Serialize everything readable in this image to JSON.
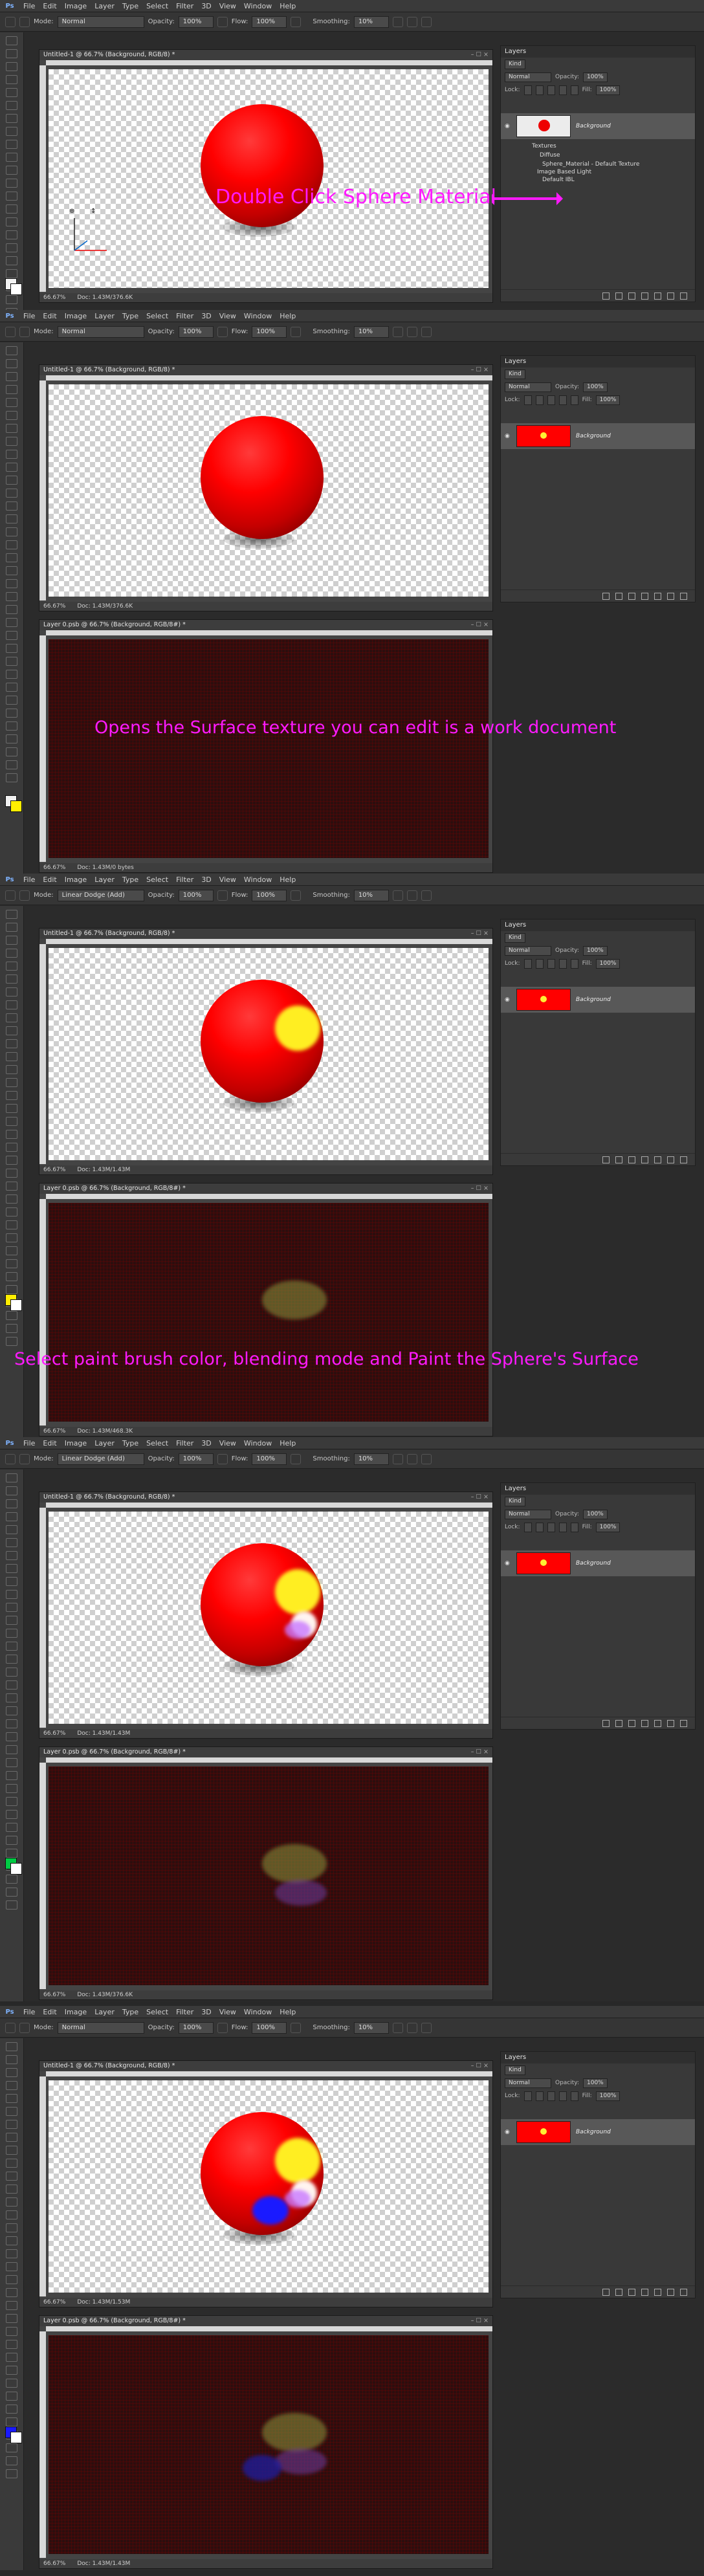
{
  "menu": [
    "File",
    "Edit",
    "Image",
    "Layer",
    "Type",
    "Select",
    "Filter",
    "3D",
    "View",
    "Window",
    "Help"
  ],
  "ps_logo": "Ps",
  "options": {
    "mode_label": "Mode:",
    "opacity_label": "Opacity:",
    "opacity_value": "100%",
    "flow_label": "Flow:",
    "flow_value": "100%",
    "smoothing_label": "Smoothing:",
    "smoothing_value": "10%"
  },
  "doc_title_main": "Untitled-1 @ 66.7% (Background, RGB/8) *",
  "doc_title_texture": "Layer 0.psb @ 66.7% (Background, RGB/8#) *",
  "zoom": "66.67%",
  "layers_panel": {
    "tab": "Layers",
    "kind": "Kind",
    "blend": "Normal",
    "opacity_label": "Opacity:",
    "opacity_value": "100%",
    "lock_label": "Lock:",
    "fill_label": "Fill:",
    "fill_value": "100%",
    "layer_name": "Background"
  },
  "panels": [
    {
      "mode": "Normal",
      "doc_status": "Doc: 1.43M/376.6K",
      "tree": [
        "Textures",
        "Diffuse",
        "Sphere_Material - Default Texture",
        "Image Based Light",
        "Default IBL"
      ],
      "annotation": "Double Click Sphere Material"
    },
    {
      "mode": "Normal",
      "doc_status": "Doc: 1.43M/376.6K",
      "tex_status": "Doc: 1.43M/0 bytes",
      "annotation": "Opens the Surface texture you can edit is a work document"
    },
    {
      "mode": "Linear Dodge (Add)",
      "doc_status": "Doc: 1.43M/1.43M",
      "tex_status": "Doc: 1.43M/468.3K",
      "annotation": "Select paint brush color, blending mode and Paint the Sphere's Surface"
    },
    {
      "mode": "Linear Dodge (Add)",
      "doc_status": "Doc: 1.43M/1.43M",
      "tex_status": "Doc: 1.43M/376.6K"
    },
    {
      "mode": "Normal",
      "doc_status": "Doc: 1.43M/1.53M",
      "tex_status": "Doc: 1.43M/1.43M"
    }
  ],
  "colors": {
    "annotation": "#ff1aff",
    "sphere": "#ff0000",
    "ui_bg": "#2b2b2b",
    "swatch_yellow": "#ffee00",
    "swatch_green": "#00cc44",
    "swatch_blue": "#1a1aff"
  }
}
